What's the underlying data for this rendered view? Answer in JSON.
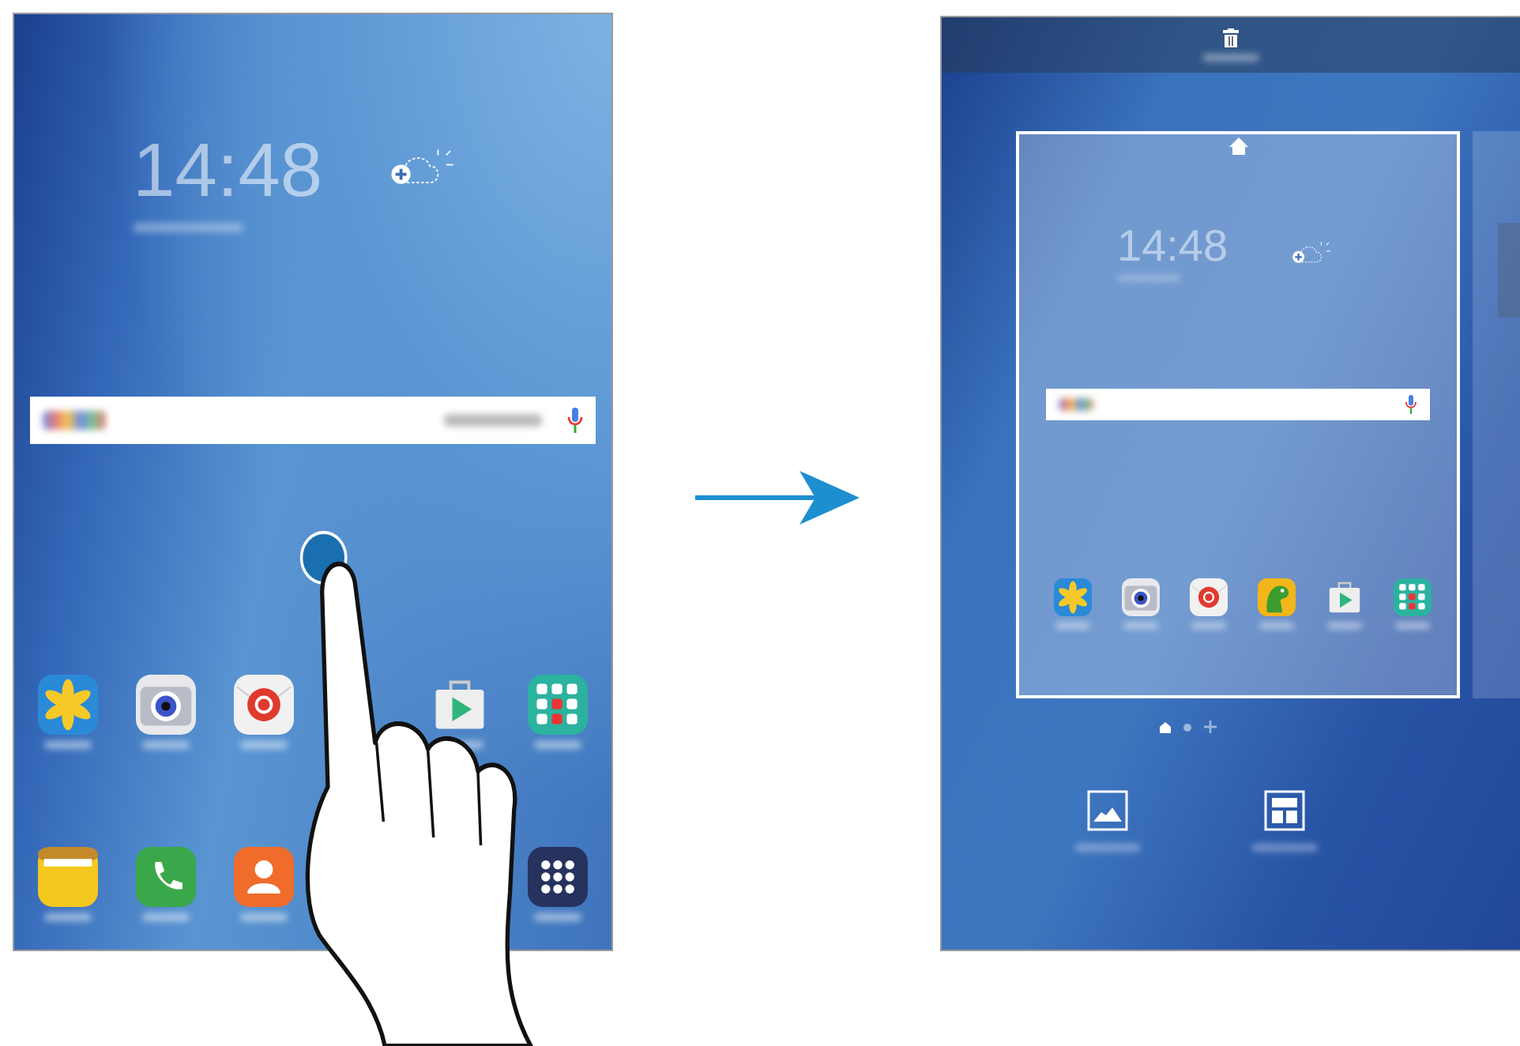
{
  "left_screen": {
    "clock": "14:48"
  },
  "right_screen": {
    "clock": "14:48",
    "page_indicators": [
      {
        "kind": "home",
        "selected": true
      },
      {
        "kind": "dot",
        "selected": false
      },
      {
        "kind": "add",
        "selected": false
      }
    ]
  }
}
